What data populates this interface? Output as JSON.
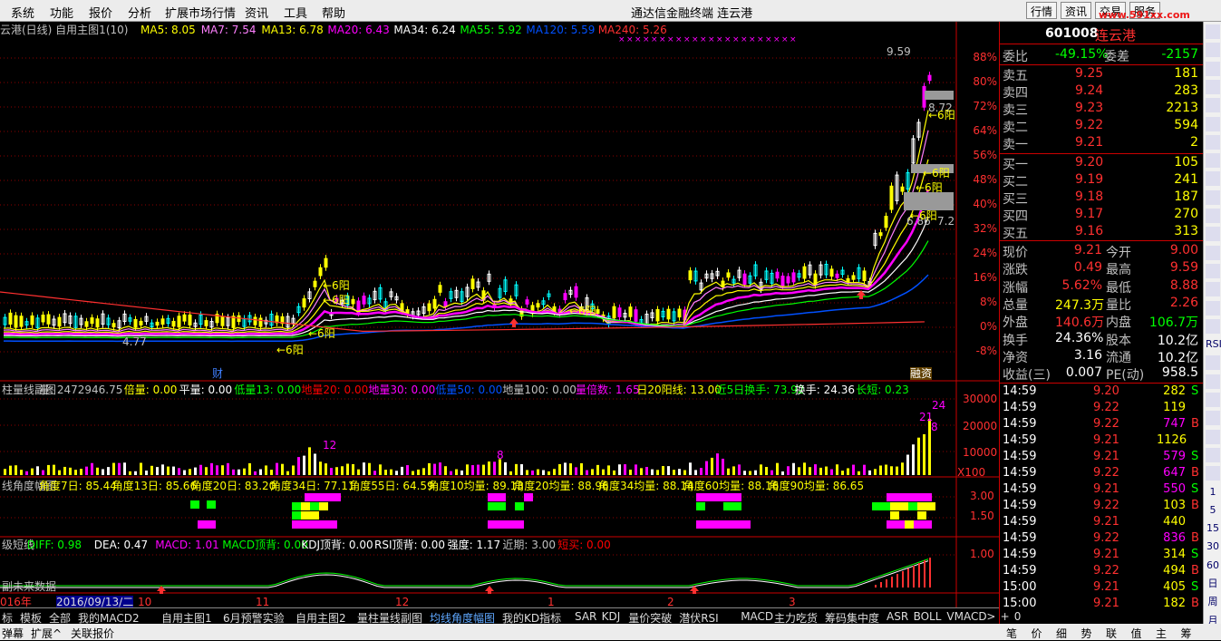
{
  "menu": [
    "系统",
    "功能",
    "报价",
    "分析",
    "扩展市场行情",
    "资讯",
    "工具",
    "帮助"
  ],
  "window_title": "通达信金融终端   连云港",
  "top_buttons": [
    "行情",
    "资讯",
    "交易",
    "服务"
  ],
  "logo_text": "www.591xx.com",
  "main_panel": {
    "title": "云港(日线) 自用主图1(10)",
    "ma": [
      {
        "label": "MA5: 8.05",
        "color": "#ffff00"
      },
      {
        "label": "MA7: 7.54",
        "color": "#ff80ff"
      },
      {
        "label": "MA13: 6.78",
        "color": "#ffff00"
      },
      {
        "label": "MA20: 6.43",
        "color": "#ff00ff"
      },
      {
        "label": "MA34: 6.24",
        "color": "#ffffff"
      },
      {
        "label": "MA55: 5.92",
        "color": "#00ff00"
      },
      {
        "label": "MA120: 5.59",
        "color": "#0050ff"
      },
      {
        "label": "MA240: 5.26",
        "color": "#ff3030"
      }
    ],
    "y_pct": [
      "88%",
      "80%",
      "72%",
      "64%",
      "56%",
      "48%",
      "40%",
      "32%",
      "24%",
      "16%",
      "8%",
      "0%",
      "-8%"
    ],
    "annot": {
      "high": "9.59",
      "p1": "8.72",
      "p2": "7.2",
      "p3": "6.86",
      "low": "4.77",
      "cai": "财",
      "rongzi": "融资",
      "sixyang": "←6阳"
    }
  },
  "vol_panel": {
    "items": [
      {
        "t": "柱量线副图",
        "c": "#c0c0c0"
      },
      {
        "t": "量: 2472946.75",
        "c": "#c0c0c0"
      },
      {
        "t": "倍量: 0.00",
        "c": "#ffff00"
      },
      {
        "t": "平量: 0.00",
        "c": "#ffffff"
      },
      {
        "t": "低量13: 0.00",
        "c": "#00ff00"
      },
      {
        "t": "地量20: 0.00",
        "c": "#ff0000"
      },
      {
        "t": "地量30: 0.00",
        "c": "#ff00ff"
      },
      {
        "t": "低量50: 0.00",
        "c": "#0050ff"
      },
      {
        "t": "地量100: 0.00",
        "c": "#c0c0c0"
      },
      {
        "t": "量倍数: 1.65",
        "c": "#ff00ff"
      },
      {
        "t": "日20阳线: 13.00",
        "c": "#ffff00"
      },
      {
        "t": "近5日换手: 73.92",
        "c": "#00ff00"
      },
      {
        "t": "换手: 24.36",
        "c": "#ffffff"
      },
      {
        "t": "长短: 0.23",
        "c": "#00ff00"
      }
    ],
    "y": [
      "30000",
      "20000",
      "10000",
      "X100"
    ],
    "labels": [
      "12",
      "8",
      "24",
      "21",
      "8"
    ]
  },
  "angle_panel": {
    "items": [
      {
        "t": "线角度幅图",
        "c": "#c0c0c0"
      },
      {
        "t": "角度7日: 85.44",
        "c": "#ffff00"
      },
      {
        "t": "角度13日: 85.66",
        "c": "#ffff00"
      },
      {
        "t": "角度20日: 83.20",
        "c": "#ffff00"
      },
      {
        "t": "角度34日: 77.11",
        "c": "#ffff00"
      },
      {
        "t": "角度55日: 64.59",
        "c": "#ffff00"
      },
      {
        "t": "角度10均量: 89.13",
        "c": "#ffff00"
      },
      {
        "t": "角度20均量: 88.96",
        "c": "#ffff00"
      },
      {
        "t": "角度34均量: 88.14",
        "c": "#ffff00"
      },
      {
        "t": "角度60均量: 88.16",
        "c": "#ffff00"
      },
      {
        "t": "角度90均量: 86.65",
        "c": "#ffff00"
      }
    ],
    "y": [
      "3.00",
      "1.50"
    ]
  },
  "macd_panel": {
    "items": [
      {
        "t": "级短线",
        "c": "#c0c0c0"
      },
      {
        "t": "DIFF: 0.98",
        "c": "#00ff00"
      },
      {
        "t": "DEA: 0.47",
        "c": "#ffffff"
      },
      {
        "t": "MACD: 1.01",
        "c": "#ff00ff"
      },
      {
        "t": "MACD顶背: 0.00",
        "c": "#00ff00"
      },
      {
        "t": "KDJ顶背: 0.00",
        "c": "#ffffff"
      },
      {
        "t": "RSI顶背: 0.00",
        "c": "#ffffff"
      },
      {
        "t": "强度: 1.17",
        "c": "#ffffff"
      },
      {
        "t": "近期: 3.00",
        "c": "#c0c0c0"
      },
      {
        "t": "短买: 0.00",
        "c": "#ff0000"
      }
    ],
    "y": [
      "1.00"
    ],
    "note": "副未来数据"
  },
  "dates": [
    "016年",
    "2016/09/13/二",
    "10",
    "11",
    "12",
    "1",
    "2",
    "3"
  ],
  "tabs": [
    "标",
    "模板",
    "全部",
    "我的MACD2",
    "自用主图1",
    "6月预警实验",
    "自用主图2",
    "量柱量线副图",
    "均线角度幅图",
    "我的KD指标",
    "SAR",
    "KDJ",
    "量价突破",
    "潜伏RSI",
    "MACD",
    "主力吃货",
    "筹码集中度",
    "ASR",
    "BOLL",
    "VMACD",
    ">",
    "+",
    "0"
  ],
  "bottom": [
    "弹幕",
    "扩展^",
    "关联报价"
  ],
  "bottom_right": [
    "笔",
    "价",
    "细",
    "势",
    "联",
    "值",
    "主",
    "筹"
  ],
  "quote": {
    "code": "601008",
    "name": "连云港",
    "wb": {
      "label": "委比",
      "value": "-49.15%",
      "label2": "委差",
      "value2": "-2157"
    },
    "sells": [
      {
        "l": "卖五",
        "p": "9.25",
        "v": "181"
      },
      {
        "l": "卖四",
        "p": "9.24",
        "v": "283"
      },
      {
        "l": "卖三",
        "p": "9.23",
        "v": "2213"
      },
      {
        "l": "卖二",
        "p": "9.22",
        "v": "594"
      },
      {
        "l": "卖一",
        "p": "9.21",
        "v": "2"
      }
    ],
    "buys": [
      {
        "l": "买一",
        "p": "9.20",
        "v": "105"
      },
      {
        "l": "买二",
        "p": "9.19",
        "v": "241"
      },
      {
        "l": "买三",
        "p": "9.18",
        "v": "187"
      },
      {
        "l": "买四",
        "p": "9.17",
        "v": "270"
      },
      {
        "l": "买五",
        "p": "9.16",
        "v": "313"
      }
    ],
    "stats": [
      {
        "a": "现价",
        "b": "9.21",
        "bc": "#ff3030",
        "c": "今开",
        "d": "9.00",
        "dc": "#ff3030"
      },
      {
        "a": "涨跌",
        "b": "0.49",
        "bc": "#ff3030",
        "c": "最高",
        "d": "9.59",
        "dc": "#ff3030"
      },
      {
        "a": "涨幅",
        "b": "5.62%",
        "bc": "#ff3030",
        "c": "最低",
        "d": "8.88",
        "dc": "#ff3030"
      },
      {
        "a": "总量",
        "b": "247.3万",
        "bc": "#ffff00",
        "c": "量比",
        "d": "2.26",
        "dc": "#ff3030"
      },
      {
        "a": "外盘",
        "b": "140.6万",
        "bc": "#ff3030",
        "c": "内盘",
        "d": "106.7万",
        "dc": "#00ff00"
      },
      {
        "a": "换手",
        "b": "24.36%",
        "bc": "#ffffff",
        "c": "股本",
        "d": "10.2亿",
        "dc": "#ffffff"
      },
      {
        "a": "净资",
        "b": "3.16",
        "bc": "#ffffff",
        "c": "流通",
        "d": "10.2亿",
        "dc": "#ffffff"
      },
      {
        "a": "收益(三)",
        "b": "0.007",
        "bc": "#ffffff",
        "c": "PE(动)",
        "d": "958.5",
        "dc": "#ffffff"
      }
    ],
    "ticks": [
      {
        "t": "14:59",
        "p": "9.20",
        "pc": "#ff3030",
        "v": "282",
        "vc": "#ffff00",
        "f": "S",
        "fc": "#00ff00"
      },
      {
        "t": "14:59",
        "p": "9.22",
        "pc": "#ff3030",
        "v": "119",
        "vc": "#ffff00",
        "f": "",
        "fc": "#ff3030"
      },
      {
        "t": "14:59",
        "p": "9.22",
        "pc": "#ff3030",
        "v": "747",
        "vc": "#ff00ff",
        "f": "B",
        "fc": "#ff3030"
      },
      {
        "t": "14:59",
        "p": "9.21",
        "pc": "#ff3030",
        "v": "1126",
        "vc": "#ffff00",
        "f": "",
        "fc": "#ff3030"
      },
      {
        "t": "14:59",
        "p": "9.21",
        "pc": "#ff3030",
        "v": "579",
        "vc": "#ff00ff",
        "f": "S",
        "fc": "#00ff00"
      },
      {
        "t": "14:59",
        "p": "9.22",
        "pc": "#ff3030",
        "v": "647",
        "vc": "#ff00ff",
        "f": "B",
        "fc": "#ff3030"
      },
      {
        "t": "14:59",
        "p": "9.21",
        "pc": "#ff3030",
        "v": "550",
        "vc": "#ff00ff",
        "f": "S",
        "fc": "#00ff00"
      },
      {
        "t": "14:59",
        "p": "9.22",
        "pc": "#ff3030",
        "v": "103",
        "vc": "#ffff00",
        "f": "B",
        "fc": "#ff3030"
      },
      {
        "t": "14:59",
        "p": "9.21",
        "pc": "#ff3030",
        "v": "440",
        "vc": "#ffff00",
        "f": "",
        "fc": "#ff3030"
      },
      {
        "t": "14:59",
        "p": "9.22",
        "pc": "#ff3030",
        "v": "836",
        "vc": "#ff00ff",
        "f": "B",
        "fc": "#ff3030"
      },
      {
        "t": "14:59",
        "p": "9.21",
        "pc": "#ff3030",
        "v": "314",
        "vc": "#ffff00",
        "f": "S",
        "fc": "#00ff00"
      },
      {
        "t": "14:59",
        "p": "9.22",
        "pc": "#ff3030",
        "v": "494",
        "vc": "#ffff00",
        "f": "B",
        "fc": "#ff3030"
      },
      {
        "t": "15:00",
        "p": "9.21",
        "pc": "#ff3030",
        "v": "405",
        "vc": "#ffff00",
        "f": "S",
        "fc": "#00ff00"
      },
      {
        "t": "15:00",
        "p": "9.21",
        "pc": "#ff3030",
        "v": "182",
        "vc": "#ffff00",
        "f": "B",
        "fc": "#ff3030"
      }
    ]
  },
  "right_toolbar": [
    "",
    "",
    "",
    "",
    "",
    "",
    "",
    "",
    "",
    "",
    "",
    "",
    "",
    "",
    "",
    "",
    "",
    "RSI",
    "",
    "",
    "",
    "",
    "",
    "",
    "",
    "1",
    "5",
    "15",
    "30",
    "60",
    "日",
    "周",
    "月"
  ],
  "right_toolbar_icons": [
    "up-arrow-icon",
    "refresh-icon",
    "list-icon",
    "window-icon",
    "chart-icon",
    "grid-icon",
    "candle-icon",
    "tick-icon",
    "kline-icon",
    "table-icon",
    "fund-icon",
    "fiz-icon",
    "line-icon",
    "screen-icon",
    "scatter-icon",
    "wave-icon",
    "bar-icon",
    "rsi-icon",
    "vol-icon",
    "flow-icon",
    "arrow-icon",
    "heart-icon",
    "star-icon",
    "calc-icon",
    "note-icon",
    "p1",
    "p5",
    "p15",
    "p30",
    "p60",
    "pd",
    "pw",
    "pm"
  ]
}
